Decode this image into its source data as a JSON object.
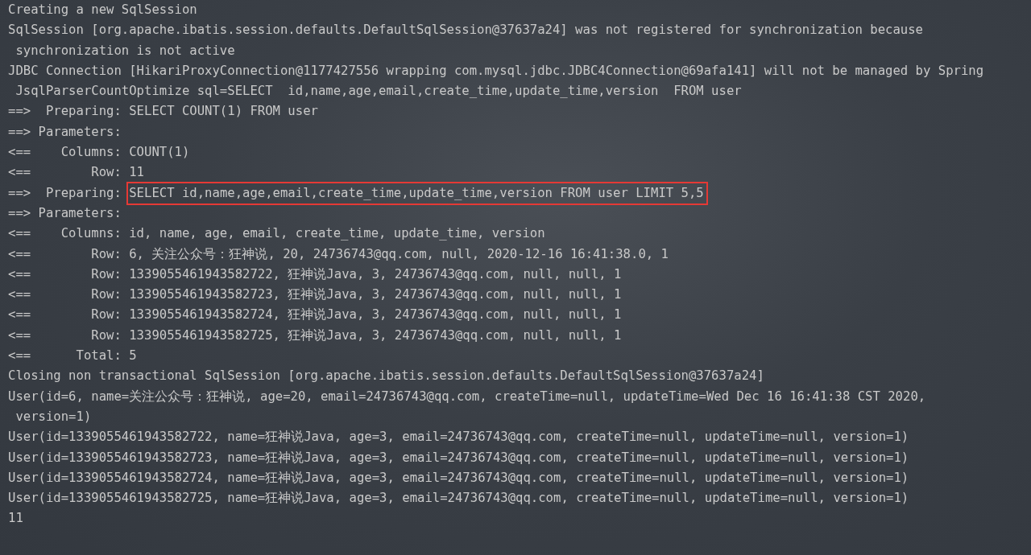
{
  "console": {
    "lines": [
      {
        "kind": "plain",
        "text": "Creating a new SqlSession"
      },
      {
        "kind": "plain",
        "text": "SqlSession [org.apache.ibatis.session.defaults.DefaultSqlSession@37637a24] was not registered for synchronization because"
      },
      {
        "kind": "plain",
        "text": " synchronization is not active"
      },
      {
        "kind": "plain",
        "text": "JDBC Connection [HikariProxyConnection@1177427556 wrapping com.mysql.jdbc.JDBC4Connection@69afa141] will not be managed by Spring"
      },
      {
        "kind": "plain",
        "text": " JsqlParserCountOptimize sql=SELECT  id,name,age,email,create_time,update_time,version  FROM user"
      },
      {
        "kind": "plain",
        "text": "==>  Preparing: SELECT COUNT(1) FROM user"
      },
      {
        "kind": "plain",
        "text": "==> Parameters: "
      },
      {
        "kind": "plain",
        "text": "<==    Columns: COUNT(1)"
      },
      {
        "kind": "plain",
        "text": "<==        Row: 11"
      },
      {
        "kind": "boxed",
        "text": "==>  Preparing: ",
        "boxed": "SELECT id,name,age,email,create_time,update_time,version FROM user LIMIT 5,5"
      },
      {
        "kind": "plain",
        "text": "==> Parameters: "
      },
      {
        "kind": "plain",
        "text": "<==    Columns: id, name, age, email, create_time, update_time, version"
      },
      {
        "kind": "plain",
        "text": "<==        Row: 6, 关注公众号：狂神说, 20, 24736743@qq.com, null, 2020-12-16 16:41:38.0, 1"
      },
      {
        "kind": "plain",
        "text": "<==        Row: 1339055461943582722, 狂神说Java, 3, 24736743@qq.com, null, null, 1"
      },
      {
        "kind": "plain",
        "text": "<==        Row: 1339055461943582723, 狂神说Java, 3, 24736743@qq.com, null, null, 1"
      },
      {
        "kind": "plain",
        "text": "<==        Row: 1339055461943582724, 狂神说Java, 3, 24736743@qq.com, null, null, 1"
      },
      {
        "kind": "plain",
        "text": "<==        Row: 1339055461943582725, 狂神说Java, 3, 24736743@qq.com, null, null, 1"
      },
      {
        "kind": "plain",
        "text": "<==      Total: 5"
      },
      {
        "kind": "plain",
        "text": "Closing non transactional SqlSession [org.apache.ibatis.session.defaults.DefaultSqlSession@37637a24]"
      },
      {
        "kind": "plain",
        "text": "User(id=6, name=关注公众号：狂神说, age=20, email=24736743@qq.com, createTime=null, updateTime=Wed Dec 16 16:41:38 CST 2020,"
      },
      {
        "kind": "plain",
        "text": " version=1)"
      },
      {
        "kind": "plain",
        "text": "User(id=1339055461943582722, name=狂神说Java, age=3, email=24736743@qq.com, createTime=null, updateTime=null, version=1)"
      },
      {
        "kind": "plain",
        "text": "User(id=1339055461943582723, name=狂神说Java, age=3, email=24736743@qq.com, createTime=null, updateTime=null, version=1)"
      },
      {
        "kind": "plain",
        "text": "User(id=1339055461943582724, name=狂神说Java, age=3, email=24736743@qq.com, createTime=null, updateTime=null, version=1)"
      },
      {
        "kind": "plain",
        "text": "User(id=1339055461943582725, name=狂神说Java, age=3, email=24736743@qq.com, createTime=null, updateTime=null, version=1)"
      },
      {
        "kind": "plain",
        "text": "11"
      }
    ]
  }
}
